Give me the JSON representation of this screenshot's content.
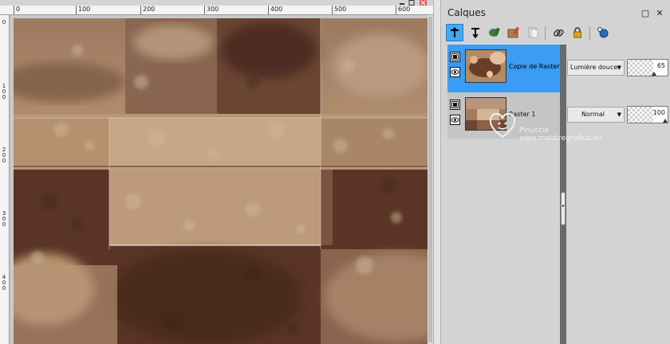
{
  "canvas": {
    "title": "",
    "ruler_h_labels": [
      "0",
      "100",
      "200",
      "300",
      "400",
      "500",
      "600"
    ],
    "ruler_v_labels": [
      "0",
      "1\n0\n0",
      "2\n0\n0",
      "3\n0\n0",
      "4\n0\n0"
    ]
  },
  "layers_panel": {
    "title": "Calques",
    "controls": {
      "restore": "▢",
      "close": "✕"
    },
    "toolbar": [
      "new-raster-layer-icon",
      "new-vector-layer-icon",
      "new-art-media-layer-icon",
      "new-mask-layer-icon",
      "duplicate-layer-icon",
      "link-layers-icon",
      "lock-transparency-icon",
      "layer-properties-icon"
    ],
    "layers": [
      {
        "name": "Copie de Raster",
        "blend_mode": "Lumière douce",
        "opacity": "65",
        "opacity_level": 65,
        "selected": true
      },
      {
        "name": "Raster 1",
        "blend_mode": "Normal",
        "opacity": "100",
        "opacity_level": 100,
        "selected": false
      }
    ]
  },
  "watermark": {
    "line1": "Pinuccia",
    "line2": "www.maidiregrafica.eu"
  },
  "colors": {
    "selection": "#3b9cf5",
    "panel_bg": "#d3d3d3",
    "splitter": "#6a6a6a"
  }
}
